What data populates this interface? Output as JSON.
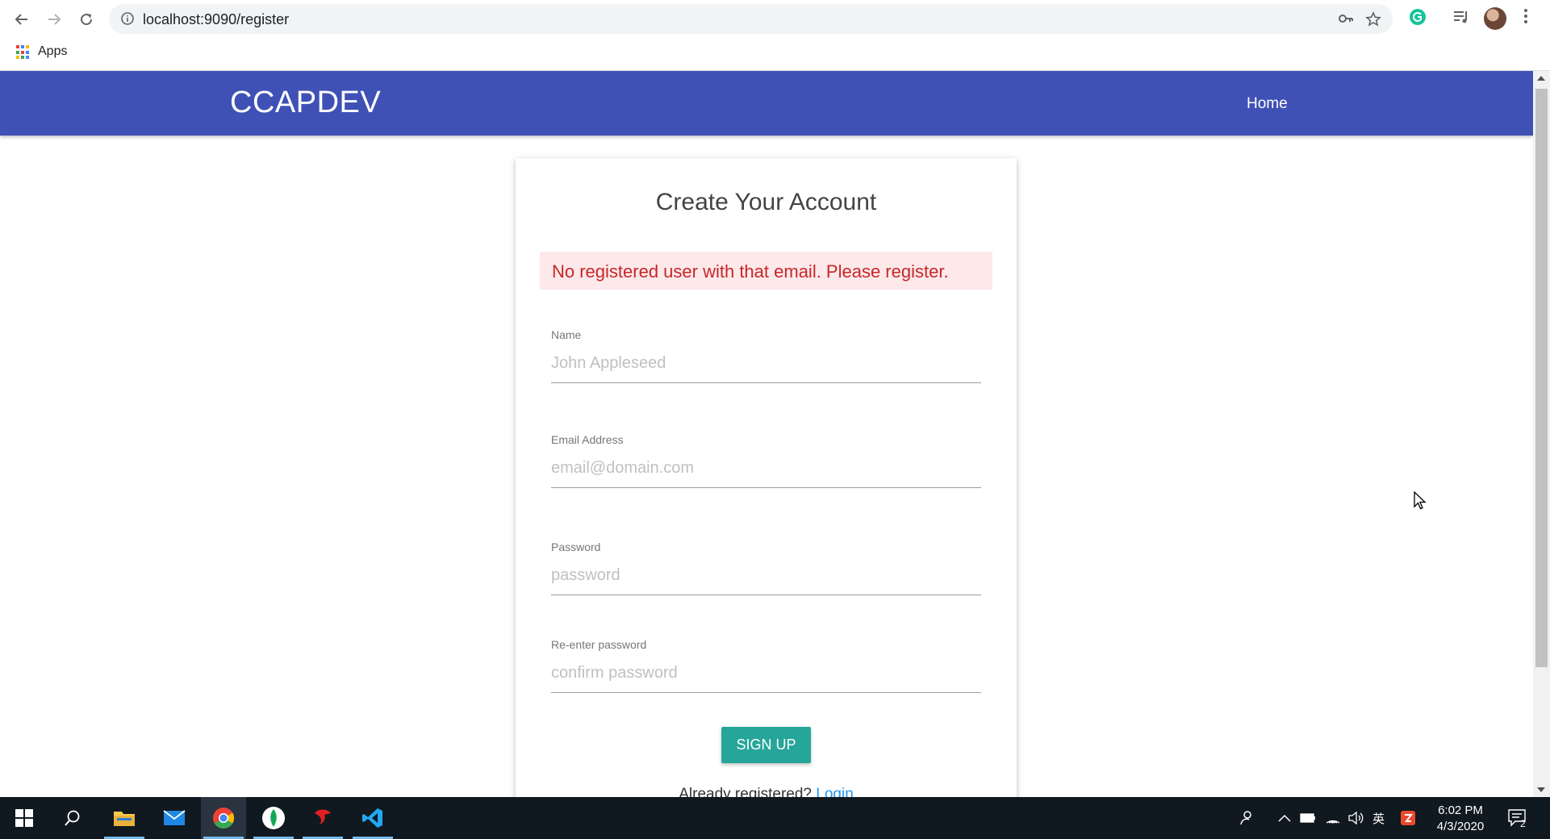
{
  "browser": {
    "url": "localhost:9090/register",
    "bookmarks_apps_label": "Apps"
  },
  "navbar": {
    "brand": "CCAPDEV",
    "home_link": "Home"
  },
  "form": {
    "title": "Create Your Account",
    "alert": "No registered user with that email. Please register.",
    "fields": {
      "name": {
        "label": "Name",
        "placeholder": "John Appleseed"
      },
      "email": {
        "label": "Email Address",
        "placeholder": "email@domain.com"
      },
      "password": {
        "label": "Password",
        "placeholder": "password"
      },
      "confirm": {
        "label": "Re-enter password",
        "placeholder": "confirm password"
      }
    },
    "submit_label": "SIGN UP",
    "login_prompt": "Already registered?",
    "login_link": "Login"
  },
  "taskbar": {
    "time": "6:02 PM",
    "date": "4/3/2020",
    "ime_label": "英",
    "notification_count": "2"
  },
  "colors": {
    "navbar": "#3f51b5",
    "button": "#26a69a",
    "alert_bg": "#fde8ea",
    "alert_text": "#c62828",
    "link": "#2196f3"
  }
}
